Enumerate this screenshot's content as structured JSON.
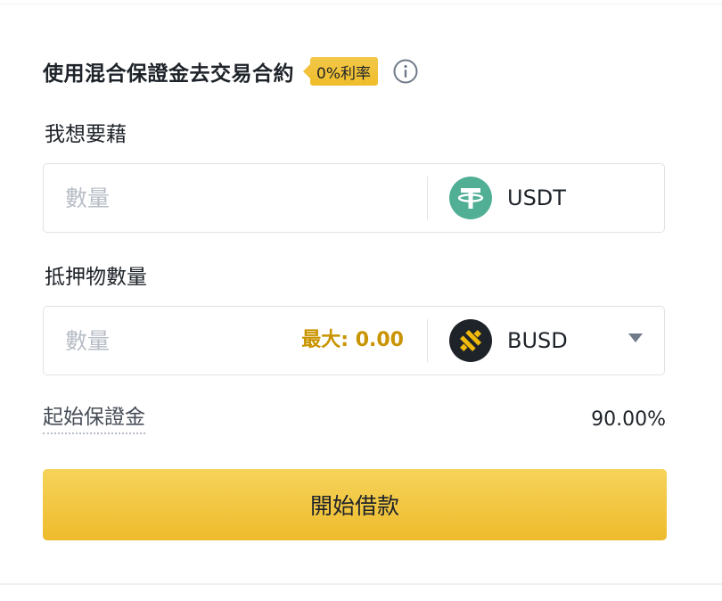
{
  "header": {
    "title": "使用混合保證金去交易合約",
    "rate_badge": "0%利率",
    "info_icon": "info-circle-icon"
  },
  "borrow": {
    "label": "我想要藉",
    "amount_placeholder": "數量",
    "coin": "USDT",
    "coin_icon": "usdt-coin-icon",
    "coin_color": "#50af95"
  },
  "collateral": {
    "label": "抵押物數量",
    "amount_placeholder": "數量",
    "max_label": "最大: 0.00",
    "coin": "BUSD",
    "coin_icon": "busd-coin-icon",
    "coin_color": "#1e2329",
    "dropdown_icon": "caret-down-icon"
  },
  "initial_margin": {
    "label": "起始保證金",
    "value": "90.00%"
  },
  "actions": {
    "borrow_button": "開始借款"
  },
  "colors": {
    "accent": "#f0b90b",
    "max_text": "#c99400",
    "text_primary": "#1e2329",
    "placeholder": "#b7bdc6"
  }
}
